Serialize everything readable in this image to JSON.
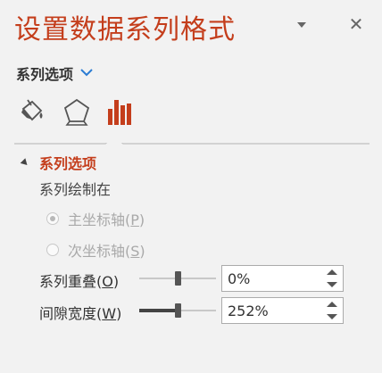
{
  "pane": {
    "title": "设置数据系列格式"
  },
  "options_dropdown": {
    "label": "系列选项"
  },
  "tabs": [
    {
      "name": "fill-line",
      "icon": "paint-bucket-icon"
    },
    {
      "name": "effects",
      "icon": "pentagon-icon"
    },
    {
      "name": "series-options",
      "icon": "bar-chart-icon",
      "active": true
    }
  ],
  "section": {
    "header": "系列选项",
    "plot_on_label": "系列绘制在",
    "primary_axis": {
      "label": "主坐标轴",
      "key": "P",
      "checked": true,
      "disabled": true
    },
    "secondary_axis": {
      "label": "次坐标轴",
      "key": "S",
      "checked": false,
      "disabled": true
    },
    "overlap": {
      "label": "系列重叠",
      "key": "O",
      "value": "0%",
      "level": 0.5
    },
    "gap_width": {
      "label": "间隙宽度",
      "key": "W",
      "value": "252%",
      "level": 0.5
    }
  },
  "colors": {
    "accent": "#c43e1c",
    "dropdown_chevron": "#2b7cd3"
  }
}
